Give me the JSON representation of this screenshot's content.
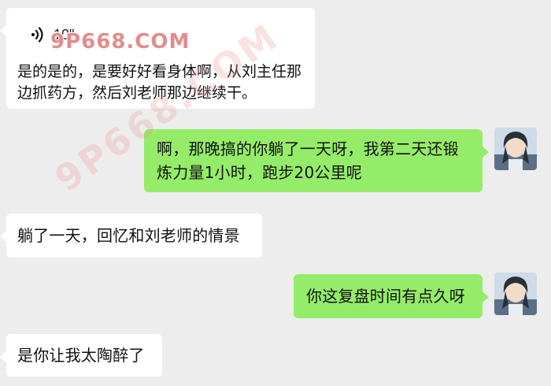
{
  "colors": {
    "background": "#ededed",
    "incoming_bubble": "#ffffff",
    "outgoing_bubble": "#95ec69",
    "watermark": "#e58b8b"
  },
  "watermarks": {
    "top": "9P668.COM",
    "diagonal": "9P668.COM"
  },
  "messages": [
    {
      "side": "incoming",
      "type": "voice",
      "icon": "voice-wave-icon",
      "duration": "10\"",
      "transcript": "是的是的，是要好好看身体啊，从刘主任那边抓药方，然后刘老师那边继续干。"
    },
    {
      "side": "outgoing",
      "type": "text",
      "text": "啊，那晚搞的你躺了一天呀，我第二天还锻炼力量1小时，跑步20公里呢"
    },
    {
      "side": "incoming",
      "type": "text",
      "text": "躺了一天，回忆和刘老师的情景"
    },
    {
      "side": "outgoing",
      "type": "text",
      "text": "你这复盘时间有点久呀"
    },
    {
      "side": "incoming",
      "type": "text",
      "text": "是你让我太陶醉了"
    }
  ]
}
